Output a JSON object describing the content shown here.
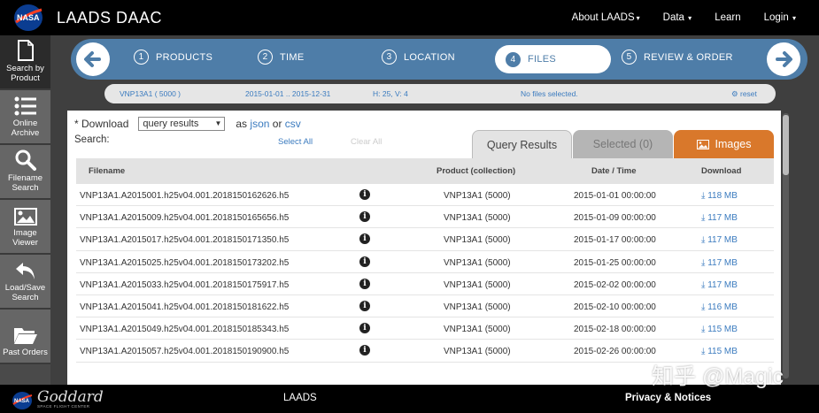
{
  "app": {
    "brand": "LAADS DAAC"
  },
  "topnav": [
    {
      "label": "About LAADS",
      "has_caret": true
    },
    {
      "label": "Data",
      "has_caret": true
    },
    {
      "label": "Learn",
      "has_caret": false
    },
    {
      "label": "Login",
      "has_caret": true
    }
  ],
  "sidebar": {
    "items": [
      {
        "label1": "Search by",
        "label2": "Product",
        "icon": "document-icon"
      },
      {
        "label1": "Online",
        "label2": "Archive",
        "icon": "list-icon"
      },
      {
        "label1": "Filename",
        "label2": "Search",
        "icon": "magnifier-icon"
      },
      {
        "label1": "Image",
        "label2": "Viewer",
        "icon": "image-icon"
      },
      {
        "label1": "Load/Save",
        "label2": "Search",
        "icon": "undo-icon"
      },
      {
        "label1": "Past Orders",
        "label2": "",
        "icon": "folder-icon"
      }
    ]
  },
  "workflow": {
    "steps": [
      {
        "num": "1",
        "label": "PRODUCTS"
      },
      {
        "num": "2",
        "label": "TIME"
      },
      {
        "num": "3",
        "label": "LOCATION"
      },
      {
        "num": "4",
        "label": "FILES"
      },
      {
        "num": "5",
        "label": "REVIEW & ORDER"
      }
    ],
    "current_step": 4
  },
  "summary": {
    "product": "VNP13A1 ( 5000 )",
    "date_range": "2015-01-01 .. 2015-12-31",
    "tile": "H: 25, V: 4",
    "files_status": "No files selected.",
    "reset": "reset"
  },
  "download": {
    "label": "* Download",
    "select_value": "query results",
    "as_text": "as",
    "json_link": "json",
    "or_text": "or",
    "csv_link": "csv",
    "search_label": "Search:",
    "select_all": "Select All",
    "clear_all": "Clear All"
  },
  "tabs": {
    "query": "Query Results",
    "selected": "Selected (0)",
    "images": "Images"
  },
  "table": {
    "headers": {
      "filename": "Filename",
      "product": "Product (collection)",
      "datetime": "Date / Time",
      "download": "Download"
    },
    "rows": [
      {
        "filename": "VNP13A1.A2015001.h25v04.001.2018150162626.h5",
        "product": "VNP13A1 (5000)",
        "datetime": "2015-01-01 00:00:00",
        "size": "118 MB"
      },
      {
        "filename": "VNP13A1.A2015009.h25v04.001.2018150165656.h5",
        "product": "VNP13A1 (5000)",
        "datetime": "2015-01-09 00:00:00",
        "size": "117 MB"
      },
      {
        "filename": "VNP13A1.A2015017.h25v04.001.2018150171350.h5",
        "product": "VNP13A1 (5000)",
        "datetime": "2015-01-17 00:00:00",
        "size": "117 MB"
      },
      {
        "filename": "VNP13A1.A2015025.h25v04.001.2018150173202.h5",
        "product": "VNP13A1 (5000)",
        "datetime": "2015-01-25 00:00:00",
        "size": "117 MB"
      },
      {
        "filename": "VNP13A1.A2015033.h25v04.001.2018150175917.h5",
        "product": "VNP13A1 (5000)",
        "datetime": "2015-02-02 00:00:00",
        "size": "117 MB"
      },
      {
        "filename": "VNP13A1.A2015041.h25v04.001.2018150181622.h5",
        "product": "VNP13A1 (5000)",
        "datetime": "2015-02-10 00:00:00",
        "size": "116 MB"
      },
      {
        "filename": "VNP13A1.A2015049.h25v04.001.2018150185343.h5",
        "product": "VNP13A1 (5000)",
        "datetime": "2015-02-18 00:00:00",
        "size": "115 MB"
      },
      {
        "filename": "VNP13A1.A2015057.h25v04.001.2018150190900.h5",
        "product": "VNP13A1 (5000)",
        "datetime": "2015-02-26 00:00:00",
        "size": "115 MB"
      }
    ]
  },
  "footer": {
    "logo_lettering": "Goddard",
    "logo_sub": "SPACE FLIGHT CENTER",
    "center": "LAADS",
    "right": "Privacy & Notices"
  },
  "watermark": "知乎 @Magic",
  "colors": {
    "workflow_blue": "#4e7da8",
    "link_blue": "#3b7bbf",
    "images_tab_orange": "#d9782b"
  }
}
